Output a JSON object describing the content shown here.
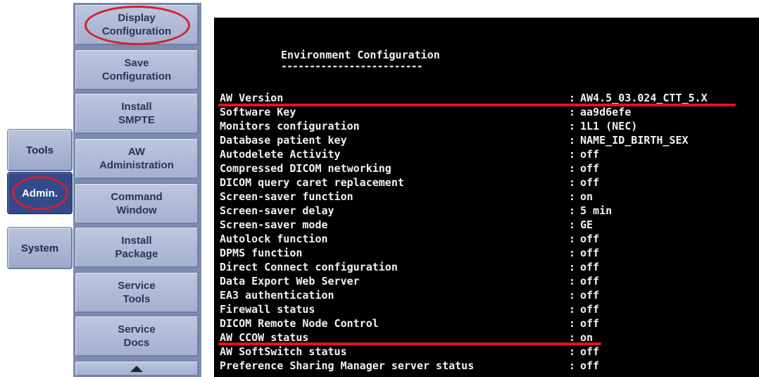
{
  "tabs": [
    {
      "label": "Tools",
      "active": false
    },
    {
      "label": "Admin.",
      "active": true
    },
    {
      "label": "System",
      "active": false
    }
  ],
  "buttons": [
    {
      "label": "Display\nConfiguration",
      "highlighted": true
    },
    {
      "label": "Save\nConfiguration"
    },
    {
      "label": "Install\nSMPTE"
    },
    {
      "label": "AW\nAdministration"
    },
    {
      "label": "Command\nWindow"
    },
    {
      "label": "Install\nPackage"
    },
    {
      "label": "Service\nTools"
    },
    {
      "label": "Service\nDocs"
    }
  ],
  "scroll_icon": "triangle-up-icon",
  "terminal": {
    "title": "Environment Configuration",
    "underline": "-------------------------",
    "separator": ":",
    "rows": [
      {
        "label": "AW Version",
        "value": "AW4.5_03.024_CTT_5.X"
      },
      {
        "label": "Software Key",
        "value": "aa9d6efe"
      },
      {
        "label": "Monitors configuration",
        "value": "1L1 (NEC)"
      },
      {
        "label": "Database patient key",
        "value": "NAME_ID_BIRTH_SEX"
      },
      {
        "label": "Autodelete Activity",
        "value": "off"
      },
      {
        "label": "Compressed DICOM networking",
        "value": "off"
      },
      {
        "label": "DICOM query caret replacement",
        "value": "off"
      },
      {
        "label": "Screen-saver function",
        "value": "on"
      },
      {
        "label": "Screen-saver delay",
        "value": "5 min"
      },
      {
        "label": "Screen-saver mode",
        "value": "GE"
      },
      {
        "label": "Autolock function",
        "value": "off"
      },
      {
        "label": "DPMS function",
        "value": "off"
      },
      {
        "label": "Direct Connect configuration",
        "value": "off"
      },
      {
        "label": "Data Export Web Server",
        "value": "off"
      },
      {
        "label": "EA3 authentication",
        "value": "off"
      },
      {
        "label": "Firewall status",
        "value": "off"
      },
      {
        "label": "DICOM Remote Node Control",
        "value": "off"
      },
      {
        "label": "AW CCOW status",
        "value": "on"
      },
      {
        "label": "AW SoftSwitch status",
        "value": "off"
      },
      {
        "label": "Preference Sharing Manager server status",
        "value": "off"
      }
    ]
  },
  "colors": {
    "highlight": "#d3202a",
    "underline_mark": "#e3141c",
    "terminal_bg": "#000000",
    "panel_bg": "#7d8bb0"
  }
}
